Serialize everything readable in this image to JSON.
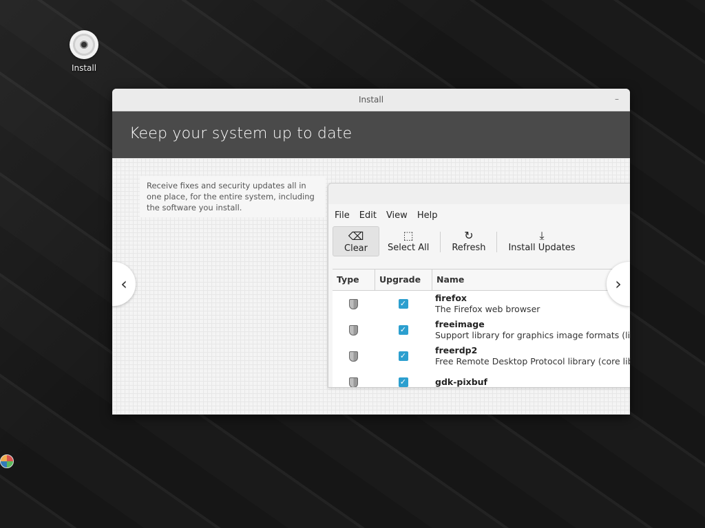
{
  "desktop": {
    "icon_label": "Install"
  },
  "window": {
    "title": "Install",
    "header_title": "Keep your system up to date",
    "description": "Receive fixes and security updates all in one place, for the entire system, including the software you install."
  },
  "app": {
    "menu": [
      "File",
      "Edit",
      "View",
      "Help"
    ],
    "toolbar": {
      "clear": "Clear",
      "select_all": "Select All",
      "refresh": "Refresh",
      "install_updates": "Install Updates"
    },
    "columns": {
      "type": "Type",
      "upgrade": "Upgrade",
      "name": "Name"
    },
    "packages": [
      {
        "name": "firefox",
        "description": "The Firefox web browser"
      },
      {
        "name": "freeimage",
        "description": "Support library for graphics image formats (libr"
      },
      {
        "name": "freerdp2",
        "description": "Free Remote Desktop Protocol library (core libr"
      },
      {
        "name": "gdk-pixbuf",
        "description": ""
      }
    ]
  },
  "colors": {
    "header_bg": "#4a4a4a",
    "checkbox": "#2c9fcf"
  }
}
